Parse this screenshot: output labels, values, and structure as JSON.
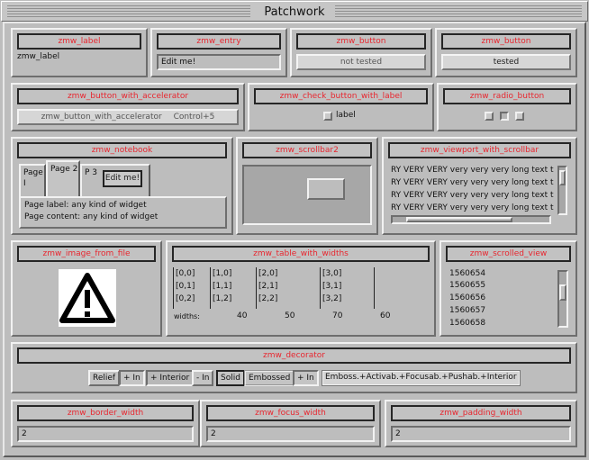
{
  "window": {
    "title": "Patchwork"
  },
  "label_panel": {
    "title": "zmw_label",
    "text": "zmw_label"
  },
  "entry_panel": {
    "title": "zmw_entry",
    "value": "Edit me!"
  },
  "button1_panel": {
    "title": "zmw_button",
    "button": "not tested"
  },
  "button2_panel": {
    "title": "zmw_button",
    "button": "tested"
  },
  "accel_panel": {
    "title": "zmw_button_with_accelerator",
    "button": "zmw_button_with_accelerator",
    "accel": "Control+5"
  },
  "check_panel": {
    "title": "zmw_check_button_with_label",
    "label": "label"
  },
  "radio_panel": {
    "title": "zmw_radio_button"
  },
  "notebook_panel": {
    "title": "zmw_notebook",
    "tabs": [
      "Page\nI",
      "Page 2",
      "P 3"
    ],
    "tab_button": "Edit me!",
    "line1": "Page label: any kind of widget",
    "line2": "Page content: any kind of widget"
  },
  "scrollbar2_panel": {
    "title": "zmw_scrollbar2"
  },
  "viewport_panel": {
    "title": "zmw_viewport_with_scrollbar",
    "lines": [
      "RY VERY VERY very very very long text t",
      "RY VERY VERY very very very long text t",
      "RY VERY VERY very very very long text t",
      "RY VERY VERY very very very long text t"
    ]
  },
  "image_panel": {
    "title": "zmw_image_from_file",
    "icon": "warning-icon"
  },
  "table_panel": {
    "title": "zmw_table_with_widths",
    "columns": [
      [
        "[0,0]",
        "[0,1]",
        "[0,2]"
      ],
      [
        "[1,0]",
        "[1,1]",
        "[1,2]"
      ],
      [
        "[2,0]",
        "[2,1]",
        "[2,2]"
      ],
      [
        "[3,0]",
        "[3,1]",
        "[3,2]"
      ]
    ],
    "widths_label": "widths:",
    "widths": [
      "40",
      "50",
      "70",
      "60"
    ]
  },
  "scrolled_panel": {
    "title": "zmw_scrolled_view",
    "items": [
      "1560654",
      "1560655",
      "1560656",
      "1560657",
      "1560658"
    ]
  },
  "decorator_panel": {
    "title": "zmw_decorator",
    "items": [
      "Relief",
      "+ In",
      "+ Interior",
      "- In",
      "Solid",
      "Embossed",
      "+ In",
      "Emboss.+Activab.+Focusab.+Pushab.+Interior"
    ]
  },
  "border_panel": {
    "title": "zmw_border_width",
    "value": "2"
  },
  "focus_panel": {
    "title": "zmw_focus_width",
    "value": "2"
  },
  "padding_panel": {
    "title": "zmw_padding_width",
    "value": "2"
  },
  "colors": {
    "accent": "#e8262f",
    "background": "#bdbdbd"
  }
}
